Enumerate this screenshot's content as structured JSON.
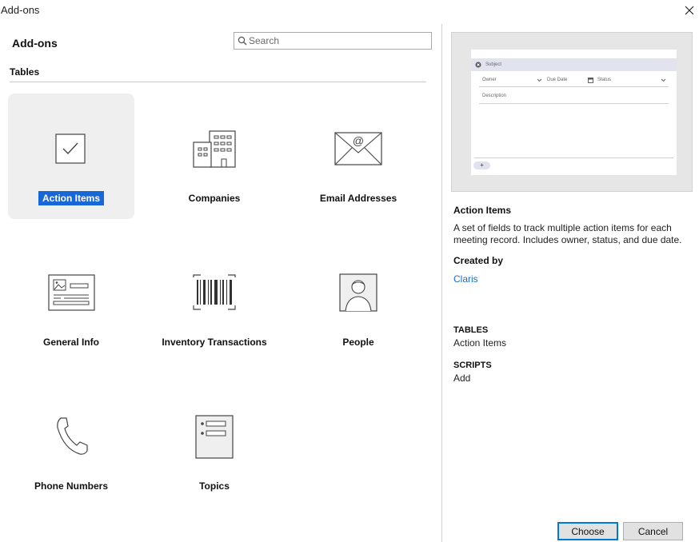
{
  "window": {
    "title": "Add-ons",
    "close_icon": "close-icon"
  },
  "header": {
    "title": "Add-ons"
  },
  "search": {
    "placeholder": "Search",
    "value": ""
  },
  "section": {
    "label": "Tables"
  },
  "tiles": [
    {
      "label": "Action Items",
      "icon": "checkbox-icon",
      "selected": true
    },
    {
      "label": "Companies",
      "icon": "buildings-icon"
    },
    {
      "label": "Email Addresses",
      "icon": "envelope-icon"
    },
    {
      "label": "General Info",
      "icon": "id-card-icon"
    },
    {
      "label": "Inventory Transactions",
      "icon": "barcode-icon"
    },
    {
      "label": "People",
      "icon": "person-icon"
    },
    {
      "label": "Phone Numbers",
      "icon": "phone-icon"
    },
    {
      "label": "Topics",
      "icon": "list-icon"
    }
  ],
  "preview": {
    "subject": "Subject",
    "owner": "Owner",
    "due_date": "Due Date",
    "status": "Status",
    "description": "Description",
    "add": "+"
  },
  "detail": {
    "title": "Action Items",
    "description": "A set of fields to track multiple action items for each meeting record. Includes owner, status, and due date.",
    "created_by_label": "Created by",
    "created_by": "Claris",
    "tables_label": "TABLES",
    "tables_value": "Action Items",
    "scripts_label": "SCRIPTS",
    "scripts_value": "Add"
  },
  "buttons": {
    "choose": "Choose",
    "cancel": "Cancel"
  },
  "colors": {
    "selection": "#1767d6",
    "link": "#1a6bc4",
    "selected_tile_bg": "#efefef"
  }
}
